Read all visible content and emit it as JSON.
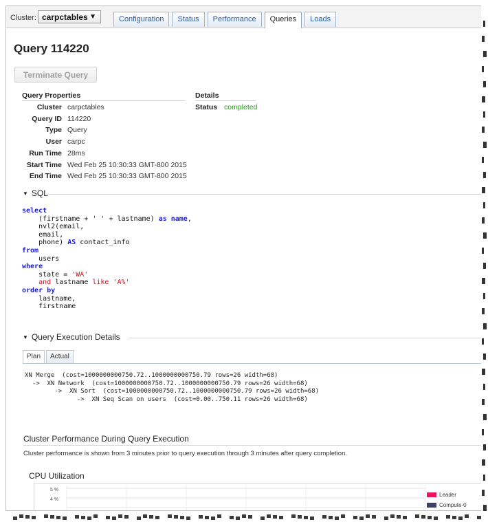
{
  "header": {
    "cluster_label": "Cluster:",
    "cluster_value": "carpctables",
    "tabs": [
      {
        "label": "Configuration",
        "active": false
      },
      {
        "label": "Status",
        "active": false
      },
      {
        "label": "Performance",
        "active": false
      },
      {
        "label": "Queries",
        "active": true
      },
      {
        "label": "Loads",
        "active": false
      }
    ]
  },
  "page": {
    "title": "Query 114220",
    "terminate_label": "Terminate Query"
  },
  "properties": {
    "heading": "Query Properties",
    "rows": [
      {
        "key": "Cluster",
        "value": "carpctables"
      },
      {
        "key": "Query ID",
        "value": "114220"
      },
      {
        "key": "Type",
        "value": "Query"
      },
      {
        "key": "User",
        "value": "carpc"
      },
      {
        "key": "Run Time",
        "value": "28ms"
      },
      {
        "key": "Start Time",
        "value": "Wed Feb 25 10:30:33 GMT-800 2015"
      },
      {
        "key": "End Time",
        "value": "Wed Feb 25 10:30:33 GMT-800 2015"
      }
    ]
  },
  "details": {
    "heading": "Details",
    "status_key": "Status",
    "status_value": "completed",
    "status_color": "#2a9a1f"
  },
  "sql": {
    "heading": "SQL",
    "lines": [
      [
        {
          "t": "select",
          "c": "kw"
        }
      ],
      [
        {
          "t": "    (firstname + ' ' + lastname) ",
          "c": ""
        },
        {
          "t": "as name",
          "c": "kw"
        },
        {
          "t": ",",
          "c": ""
        }
      ],
      [
        {
          "t": "    nvl2(email,",
          "c": ""
        }
      ],
      [
        {
          "t": "    email,",
          "c": ""
        }
      ],
      [
        {
          "t": "    phone) ",
          "c": ""
        },
        {
          "t": "AS",
          "c": "kw"
        },
        {
          "t": " contact_info",
          "c": ""
        }
      ],
      [
        {
          "t": "from",
          "c": "kw"
        }
      ],
      [
        {
          "t": "    users",
          "c": ""
        }
      ],
      [
        {
          "t": "where",
          "c": "kw"
        }
      ],
      [
        {
          "t": "    state = ",
          "c": ""
        },
        {
          "t": "'WA'",
          "c": "str"
        }
      ],
      [
        {
          "t": "    ",
          "c": ""
        },
        {
          "t": "and",
          "c": "kw2"
        },
        {
          "t": " lastname ",
          "c": ""
        },
        {
          "t": "like",
          "c": "kw2"
        },
        {
          "t": " ",
          "c": ""
        },
        {
          "t": "'A%'",
          "c": "str"
        }
      ],
      [
        {
          "t": "order by",
          "c": "kw"
        }
      ],
      [
        {
          "t": "    lastname,",
          "c": ""
        }
      ],
      [
        {
          "t": "    firstname",
          "c": ""
        }
      ]
    ]
  },
  "execution": {
    "heading": "Query Execution Details",
    "tabs": [
      {
        "label": "Plan",
        "active": true
      },
      {
        "label": "Actual",
        "active": false
      }
    ],
    "plan_lines": [
      "XN Merge  (cost=1000000000750.72..1000000000750.79 rows=26 width=68)",
      "  ->  XN Network  (cost=1000000000750.72..1000000000750.79 rows=26 width=68)",
      "        ->  XN Sort  (cost=1000000000750.72..1000000000750.79 rows=26 width=68)",
      "              ->  XN Seq Scan on users  (cost=0.00..750.11 rows=26 width=68)"
    ]
  },
  "performance": {
    "heading": "Cluster Performance During Query Execution",
    "description": "Cluster performance is shown from 3 minutes prior to query execution through 3 minutes after query completion.",
    "cpu_heading": "CPU Utilization"
  },
  "chart_data": {
    "type": "line",
    "title": "CPU Utilization",
    "ytick_labels": [
      "5 %",
      "4 %"
    ],
    "series": [
      {
        "name": "Leader",
        "color": "#e8175d"
      },
      {
        "name": "Compute-0",
        "color": "#3a3f6b"
      }
    ]
  }
}
